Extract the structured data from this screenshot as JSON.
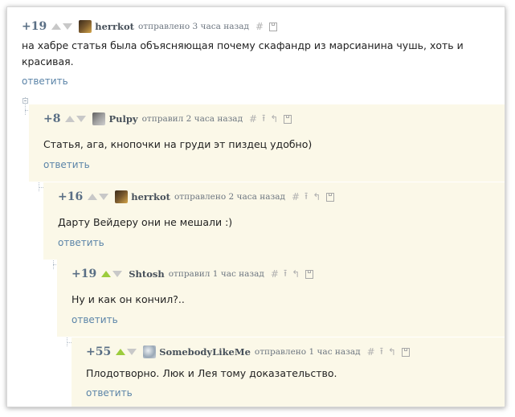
{
  "comments": [
    {
      "score": "+19",
      "author": "herrkot",
      "meta": "отправлено 3 часа назад",
      "text": "на хабре статья была объясняющая почему скафандр из марсианина чушь, хоть и красивая.",
      "reply": "ответить",
      "vote_up_active": false
    },
    {
      "score": "+8",
      "author": "Pulpy",
      "meta": "отправил 2 часа назад",
      "text": "Статья, ага, кнопочки на груди эт пиздец удобно)",
      "reply": "ответить",
      "vote_up_active": false
    },
    {
      "score": "+16",
      "author": "herrkot",
      "meta": "отправлено 2 часа назад",
      "text": "Дарту Вейдеру они не мешали :)",
      "reply": "ответить",
      "vote_up_active": false
    },
    {
      "score": "+19",
      "author": "Shtosh",
      "meta": "отправил 1 час назад",
      "text": "Ну и как он кончил?..",
      "reply": "ответить",
      "vote_up_active": true
    },
    {
      "score": "+55",
      "author": "SomebodyLikeMe",
      "meta": "отправлено 1 час назад",
      "text": "Плодотворно. Люк и Лея тому доказательство.",
      "reply": "ответить",
      "vote_up_active": true
    }
  ],
  "icons": {
    "hash": "#",
    "up": "⭱",
    "parent": "↰",
    "save": "save-icon"
  },
  "colors": {
    "score": "#5a6f85",
    "link": "#5b84a8",
    "comment_bg": "#fbf8e8",
    "vote_up_active": "#9ccc3c"
  }
}
